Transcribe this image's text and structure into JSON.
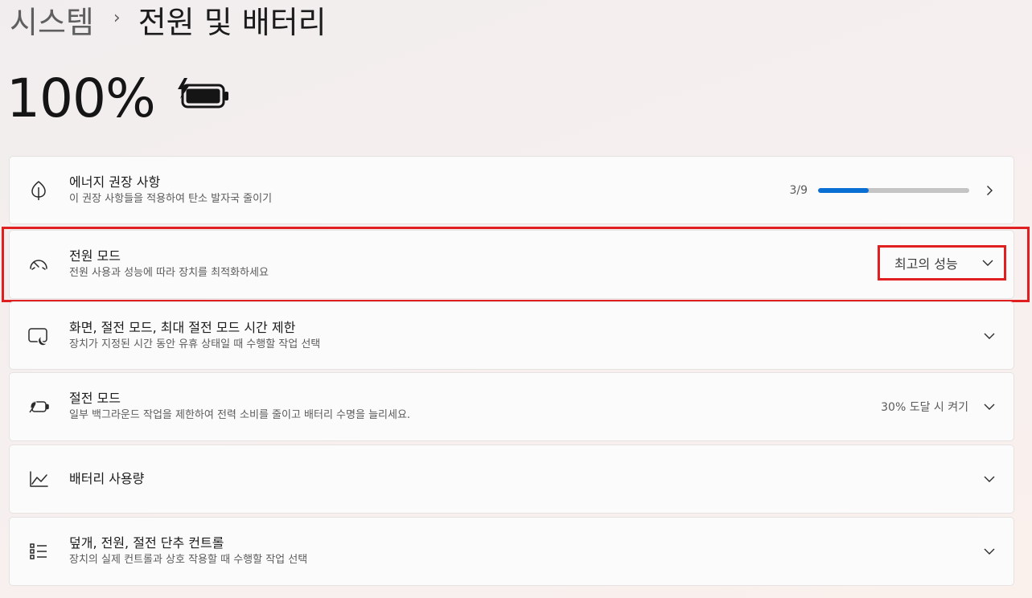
{
  "breadcrumb": {
    "parent": "시스템",
    "separator": "›",
    "current": "전원 및 배터리"
  },
  "battery": {
    "percent_text": "100%",
    "icon": "battery-charging-icon",
    "level": 1.0
  },
  "cards": {
    "energy": {
      "icon": "leaf-icon",
      "title": "에너지 권장 사항",
      "subtitle": "이 권장 사항들을 적용하여 탄소 발자국 줄이기",
      "progress_text": "3/9",
      "progress_fraction": 0.333
    },
    "power_mode": {
      "icon": "gauge-icon",
      "title": "전원 모드",
      "subtitle": "전원 사용과 성능에 따라 장치를 최적화하세요",
      "selected": "최고의 성능"
    },
    "screen_sleep": {
      "icon": "screen-sleep-icon",
      "title": "화면, 절전 모드, 최대 절전 모드 시간 제한",
      "subtitle": "장치가 지정된 시간 동안 유휴 상태일 때 수행할 작업 선택"
    },
    "battery_saver": {
      "icon": "battery-saver-icon",
      "title": "절전 모드",
      "subtitle": "일부 백그라운드 작업을 제한하여 전력 소비를 줄이고 배터리 수명을 늘리세요.",
      "status": "30% 도달 시 켜기"
    },
    "battery_usage": {
      "icon": "chart-icon",
      "title": "배터리 사용량"
    },
    "lid_controls": {
      "icon": "list-icon",
      "title": "덮개, 전원, 절전 단추 컨트롤",
      "subtitle": "장치의 실제 컨트롤과 상호 작용할 때 수행할 작업 선택"
    }
  },
  "colors": {
    "accent": "#0a6fd2",
    "highlight": "#e02020"
  }
}
